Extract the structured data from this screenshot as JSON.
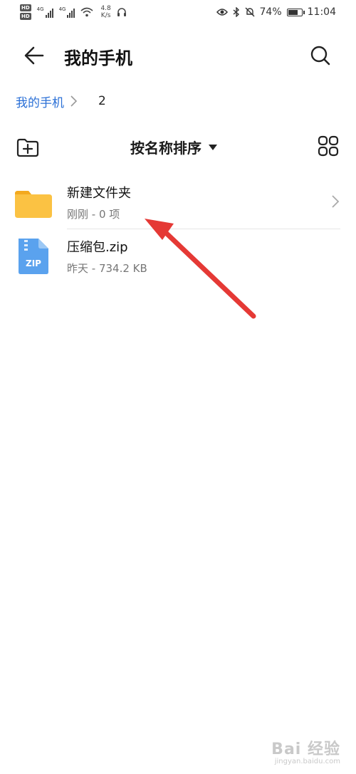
{
  "status_bar": {
    "left_badges": [
      "HD",
      "HD"
    ],
    "signal_labels": [
      "4G",
      "4G"
    ],
    "net_speed_value": "4.8",
    "net_speed_unit": "K/s",
    "battery_percent": "74%",
    "battery_level": 0.74,
    "time": "11:04"
  },
  "header": {
    "title": "我的手机"
  },
  "breadcrumb": {
    "root": "我的手机",
    "current": "2"
  },
  "toolbar": {
    "sort_label": "按名称排序"
  },
  "files": [
    {
      "name": "新建文件夹",
      "meta": "刚刚 - 0 项",
      "type": "folder",
      "icon": "folder-icon"
    },
    {
      "name": "压缩包.zip",
      "meta": "昨天 - 734.2 KB",
      "type": "zip",
      "icon": "zip-file-icon",
      "icon_label": "ZIP"
    }
  ],
  "colors": {
    "accent": "#2a6fd6",
    "folder": "#fbc243",
    "zip": "#5aa2ee",
    "annotation": "#e53935"
  },
  "watermark": {
    "main": "Bai 经验",
    "sub": "jingyan.baidu.com"
  }
}
